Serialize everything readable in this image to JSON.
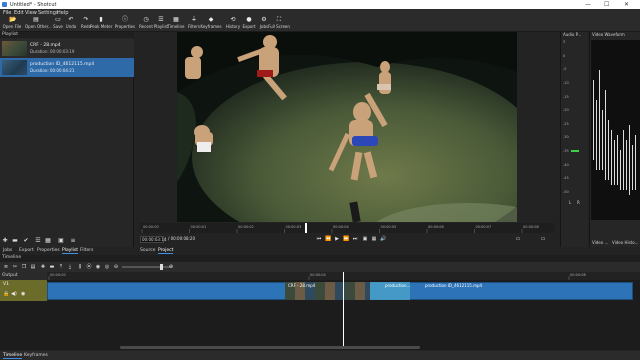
{
  "window": {
    "title": "Untitled* - Shotcut",
    "min_glyph": "—",
    "max_glyph": "☐",
    "close_glyph": "✕"
  },
  "menu": [
    "File",
    "Edit",
    "View",
    "Settings",
    "Help"
  ],
  "toolbar": [
    {
      "label": "Open File",
      "icon": "folder-icon",
      "glyph": "📂"
    },
    {
      "label": "Open Other...",
      "icon": "open-other-icon",
      "glyph": "▤"
    },
    {
      "label": "Save",
      "icon": "save-icon",
      "glyph": "▭"
    },
    {
      "label": "Undo",
      "icon": "undo-icon",
      "glyph": "↶"
    },
    {
      "label": "Redo",
      "icon": "redo-icon",
      "glyph": "↷"
    },
    {
      "label": "Peak Meter",
      "icon": "peak-meter-icon",
      "glyph": "▮"
    },
    {
      "label": "Properties",
      "icon": "properties-icon",
      "glyph": "ⓘ"
    },
    {
      "label": "Recent",
      "icon": "recent-icon",
      "glyph": "◷"
    },
    {
      "label": "Playlist",
      "icon": "playlist-icon",
      "glyph": "☰"
    },
    {
      "label": "Timeline",
      "icon": "timeline-icon",
      "glyph": "▦"
    },
    {
      "label": "Filters",
      "icon": "filters-icon",
      "glyph": "⏚"
    },
    {
      "label": "Keyframes",
      "icon": "keyframes-icon",
      "glyph": "◆"
    },
    {
      "label": "History",
      "icon": "history-icon",
      "glyph": "⟲"
    },
    {
      "label": "Export",
      "icon": "export-icon",
      "glyph": "●"
    },
    {
      "label": "Jobs",
      "icon": "jobs-icon",
      "glyph": "⚙"
    },
    {
      "label": "Full Screen",
      "icon": "fullscreen-icon",
      "glyph": "⛶"
    }
  ],
  "playlist": {
    "title": "Playlist",
    "items": [
      {
        "name": "CRF - 28.mp4",
        "duration": "Duration: 00:00:03:19",
        "selected": false
      },
      {
        "name": "production ID_4612115.mp4",
        "duration": "Duration: 00:00:04:21",
        "selected": true
      }
    ],
    "tabs": [
      "Jobs",
      "Export",
      "Properties",
      "Playlist",
      "Filters"
    ],
    "active_tab": "Playlist"
  },
  "player": {
    "ruler_ticks": [
      "00:00:00",
      "00:00:01",
      "00:00:02",
      "00:00:03",
      "00:00:04",
      "00:00:05",
      "00:00:06",
      "00:00:07",
      "00:00:08"
    ],
    "current_time": "00:00:03:14",
    "total_time": "/ 00:00:08:20",
    "tabs": [
      "Source",
      "Project"
    ],
    "active_tab": "Project"
  },
  "audio_peak": {
    "title": "Audio P...",
    "scale": [
      "3",
      "0",
      "-5",
      "-10",
      "-15",
      "-20",
      "-25",
      "-30",
      "-35",
      "-40",
      "-45",
      "-50"
    ],
    "channels": [
      "L",
      "R"
    ]
  },
  "waveform": {
    "title": "Video Waveform"
  },
  "right_tabs": [
    "Video ...",
    "Video Histo..."
  ],
  "timeline": {
    "title": "Timeline",
    "output_label": "Output",
    "track_name": "V1",
    "ruler_ticks": [
      "00:00:00",
      "00:00:04",
      "00:00:08"
    ],
    "clips": [
      {
        "name": "CRF - 28.mp4"
      },
      {
        "name": "production..."
      },
      {
        "name": "production ID_4612115.mp4"
      }
    ]
  },
  "bottom_tabs": [
    "Timeline",
    "Keyframes"
  ],
  "colors": {
    "accent": "#3d8ee8",
    "clip": "#2d73b8",
    "track_head": "#6b6b2a",
    "playhead": "#ffffff"
  }
}
